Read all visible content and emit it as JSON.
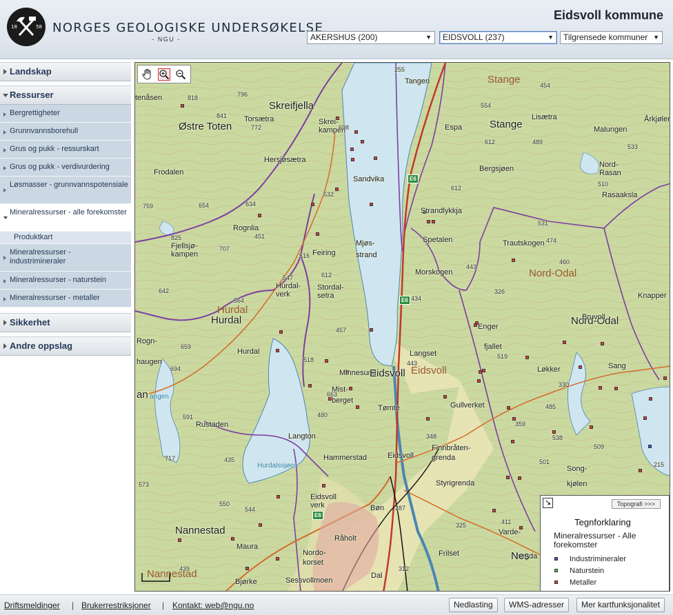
{
  "header": {
    "logo_years": [
      "18",
      "58"
    ],
    "org_name": "NORGES GEOLOGISKE UNDERSØKELSE",
    "org_abbr": "- NGU -",
    "municipality_title": "Eidsvoll kommune",
    "county_select": "AKERSHUS (200)",
    "municipality_select": "EIDSVOLL (237)",
    "neighbours_select": "Tilgrensede kommuner"
  },
  "sidebar": {
    "sections": [
      {
        "label": "Landskap"
      },
      {
        "label": "Ressurser"
      },
      {
        "label": "Sikkerhet"
      },
      {
        "label": "Andre oppslag"
      }
    ],
    "resource_items": [
      {
        "label": "Bergrettigheter"
      },
      {
        "label": "Grunnvannsborehull"
      },
      {
        "label": "Grus og pukk - ressurskart"
      },
      {
        "label": "Grus og pukk - verdivurdering"
      },
      {
        "label": "Løsmasser - grunnvannspotensiale"
      },
      {
        "label": "Mineralressurser - alle forekomster"
      },
      {
        "label": "Mineralressurser - industrimineraler"
      },
      {
        "label": "Mineralressurser - naturstein"
      },
      {
        "label": "Mineralressurser - metaller"
      }
    ],
    "sub_item": "Produktkart"
  },
  "map": {
    "road_shield": "E6",
    "labels": {
      "skreifjella": "Skreifjella",
      "ostre_toten": "Østre Toten",
      "torsaetra": "Torsætra",
      "skrei_kampen": "Skrei-kampen",
      "hersjosaetra": "Hersjøsætra",
      "sandvika": "Sandvika",
      "frodalen": "Frodalen",
      "rognlia": "Rognlia",
      "fjellsjokampen": "Fjellsjø-kampen",
      "feiring": "Feiring",
      "mjosstrand": "Mjøs-strand",
      "hurdal_verk": "Hurdal-verk",
      "stordalsetra": "Stordal-setra",
      "hurdal_muni": "Hurdal",
      "hurdal": "Hurdal",
      "hurdal_small": "Hurdal",
      "rognhaugen": "Rogn-haugen",
      "rustaden": "Rustaden",
      "langton": "Langton",
      "hurdalssjoen": "Hurdalssjøen",
      "minnesund": "Minnesund",
      "mistberget": "Mist-berget",
      "eidsvoll": "Eidsvoll",
      "eidsvoll_muni": "Eidsvoll",
      "tomte": "Tømte",
      "hammerstad": "Hammerstad",
      "eidsvoll_small": "Eidsvoll",
      "langset": "Langset",
      "eidsvoll_verk": "Eidsvoll verk",
      "bon": "Bøn",
      "raholt": "Råholt",
      "nordokorset": "Nordo-korset",
      "dal": "Dal",
      "sessvollmoen": "Sessvollmoen",
      "bjorke": "Bjørke",
      "maura": "Maura",
      "nannestad": "Nannestad",
      "nannestad_muni": "Nannestad",
      "tangen": "Tangen",
      "stange_muni": "Stange",
      "stange": "Stange",
      "espa": "Espa",
      "lisaetra": "Lisætra",
      "malungen": "Malungen",
      "arkjolen": "Årkjølen",
      "nordrasan": "Nord-Rasan",
      "rasaaksla": "Rasaaksla",
      "bergsjoen": "Bergsjøen",
      "strandlykkja": "Strandlykkja",
      "spetalen": "Spetalen",
      "trautskogen": "Trautskogen",
      "morskogen": "Morskogen",
      "nordodal_muni": "Nord-Odal",
      "nordodal": "Nord-Odal",
      "knapper": "Knapper",
      "bruvoll": "Bruvoll",
      "enger": "Enger",
      "fjallet": "fjallet",
      "lokker": "Løkker",
      "sang": "Sang",
      "gullverket": "Gullverket",
      "finnbratengrenda": "Finnbråten-grenda",
      "styrigrenda": "Styrigrenda",
      "songkjolen": "Song-kjølen",
      "varde": "Varde-",
      "frilset": "Frilset",
      "hogda": "høgda",
      "nes": "Nes",
      "tenasen": "tenåsen",
      "an": "an",
      "tangen_w": "angen",
      "n818": "818",
      "n841": "841",
      "n772": "772",
      "n796": "796",
      "n698": "698",
      "n759": "759",
      "n654": "654",
      "n634": "634",
      "n532": "532",
      "n825": "825",
      "n707": "707",
      "n451": "451",
      "n516": "516",
      "n547": "547",
      "n612w": "612",
      "n642": "642",
      "n564": "564",
      "n457": "457",
      "n659": "659",
      "n694": "694",
      "n518": "518",
      "n591": "591",
      "n663": "663",
      "n480": "480",
      "n717": "717",
      "n435": "435",
      "n573": "573",
      "n550": "550",
      "n544": "544",
      "n439": "439",
      "n255": "255",
      "n454": "454",
      "n554": "554",
      "n612": "612",
      "n489": "489",
      "n533": "533",
      "n510": "510",
      "n612b": "612",
      "n531": "531",
      "n474": "474",
      "n443": "443",
      "n460": "460",
      "n326": "326",
      "n434": "434",
      "n443b": "443",
      "n519": "519",
      "n485": "485",
      "n330": "330",
      "n359": "359",
      "n538": "538",
      "n509": "509",
      "n348": "348",
      "n501": "501",
      "n215": "215",
      "n287": "287",
      "n325": "325",
      "n411": "411",
      "n312": "312"
    }
  },
  "legend": {
    "topo_button": "Topografi >>>",
    "title": "Tegnforklaring",
    "layer": "Mineralressurser - Alle forekomster",
    "entries": [
      {
        "label": "Industrimineraler",
        "color": "#3b4fd9"
      },
      {
        "label": "Naturstein",
        "color": "#4cc24c"
      },
      {
        "label": "Metaller",
        "color": "#e23b3b"
      }
    ]
  },
  "footer": {
    "links": [
      "Driftsmeldinger",
      "Brukerrestriksjoner",
      "Kontakt: web@ngu.no"
    ],
    "buttons": [
      "Nedlasting",
      "WMS-adresser",
      "Mer kartfunksjonalitet"
    ]
  }
}
